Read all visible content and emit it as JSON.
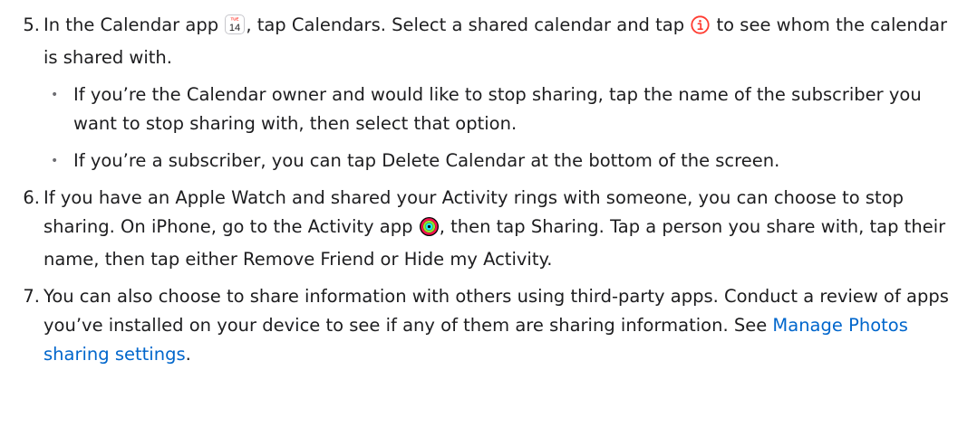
{
  "steps": [
    {
      "number": "5.",
      "text_before_cal_icon": "In the Calendar app",
      "text_after_cal_icon": ", tap Calendars. Select a shared calendar and tap",
      "text_after_info_icon": "to see whom the calendar is shared with.",
      "calendar_icon": {
        "name": "calendar-app-icon",
        "day_label": "TUE",
        "date_label": "14"
      },
      "info_icon": {
        "name": "info-icon",
        "color": "#ff3b30"
      },
      "bullets": [
        "If you’re the Calendar owner and would like to stop sharing, tap the name of the subscriber you want to stop sharing with, then select that option.",
        "If you’re a subscriber, you can tap Delete Calendar at the bottom of the screen."
      ]
    },
    {
      "number": "6.",
      "text_before_icon": "If you have an Apple Watch and shared your Activity rings with someone, you can choose to stop sharing. On iPhone, go to the Activity app",
      "text_after_icon": ", then tap Sharing. Tap a person you share with, tap their name, then tap either Remove Friend or Hide my Activity.",
      "activity_icon": {
        "name": "activity-app-icon",
        "colors": [
          "#fa114f",
          "#92e82a",
          "#1eeaef"
        ]
      }
    },
    {
      "number": "7.",
      "text_before_link": "You can also choose to share information with others using third-party apps. Conduct a review of apps you’ve installed on your device to see if any of them are sharing information. See",
      "link_text": "Manage Photos sharing settings",
      "text_after_link": "."
    }
  ],
  "colors": {
    "text": "#1d1d1f",
    "link": "#0066cc",
    "bullet": "#6e6e73"
  }
}
